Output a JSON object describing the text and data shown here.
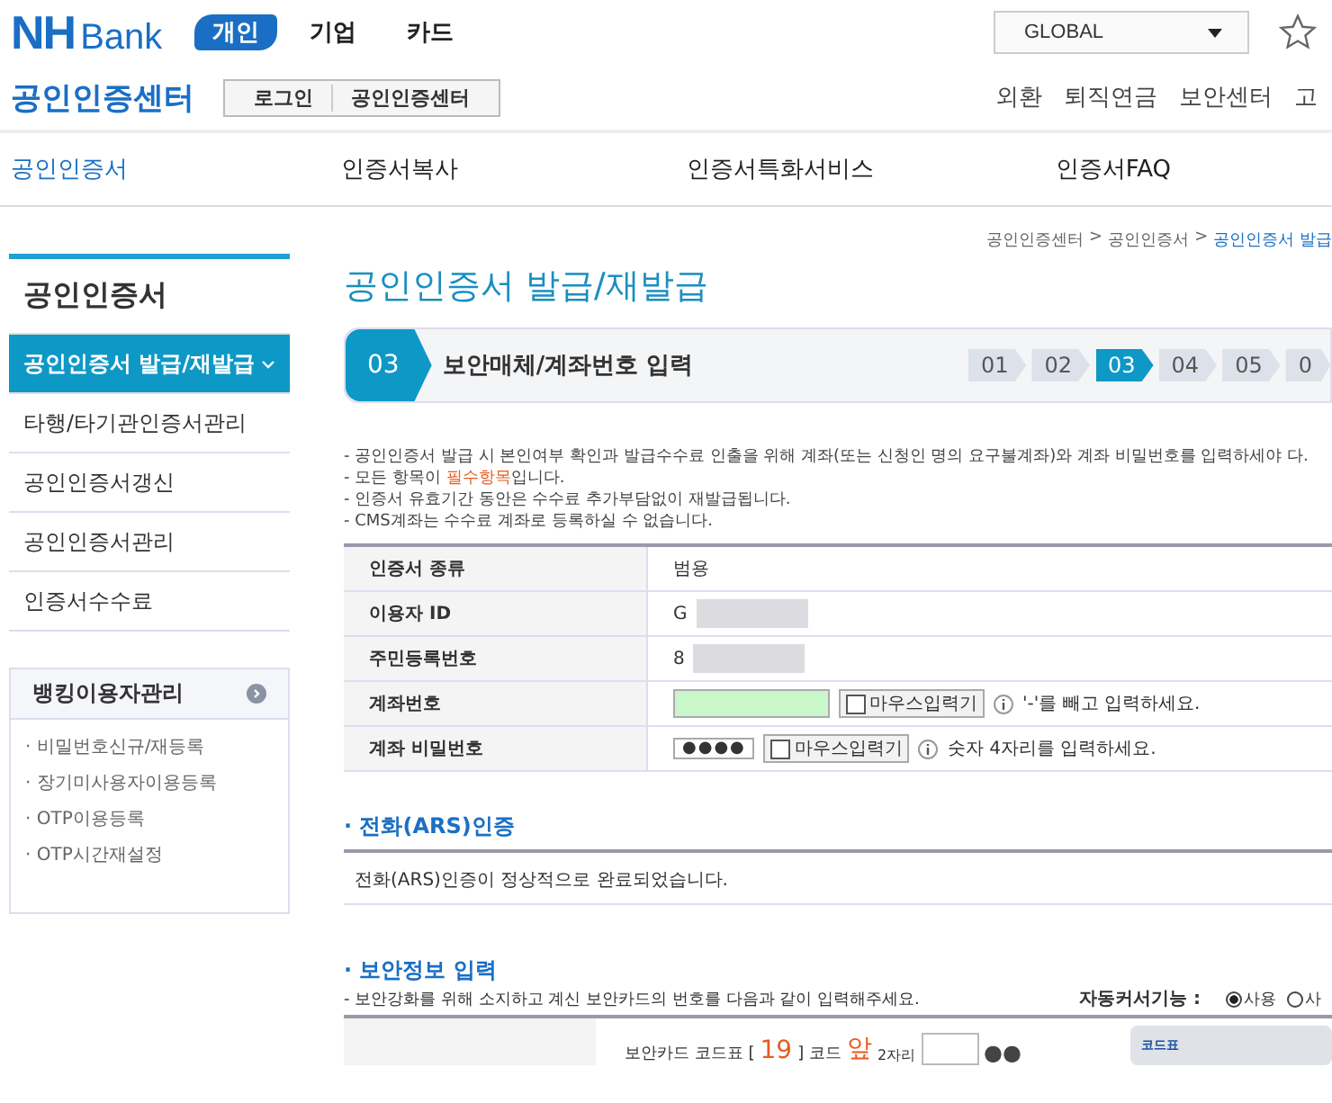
{
  "header": {
    "logo": {
      "mark": "NH",
      "word": "Bank"
    },
    "segments": [
      {
        "label": "개인",
        "selected": true
      },
      {
        "label": "기업",
        "selected": false
      },
      {
        "label": "카드",
        "selected": false
      }
    ],
    "global_select": {
      "value": "GLOBAL"
    },
    "center_title": "공인인증센터",
    "center_buttons": [
      "로그인",
      "공인인증센터"
    ],
    "links": [
      "외환",
      "퇴직연금",
      "보안센터",
      "고"
    ]
  },
  "nav": [
    {
      "label": "공인인증서",
      "selected": true
    },
    {
      "label": "인증서복사",
      "selected": false
    },
    {
      "label": "인증서특화서비스",
      "selected": false
    },
    {
      "label": "인증서FAQ",
      "selected": false
    }
  ],
  "sidebar": {
    "title": "공인인증서",
    "items": [
      {
        "label": "공인인증서 발급/재발급",
        "selected": true
      },
      {
        "label": "타행/타기관인증서관리",
        "selected": false
      },
      {
        "label": "공인인증서갱신",
        "selected": false
      },
      {
        "label": "공인인증서관리",
        "selected": false
      },
      {
        "label": "인증서수수료",
        "selected": false
      }
    ],
    "panel": {
      "title": "뱅킹이용자관리",
      "links": [
        "· 비밀번호신규/재등록",
        "· 장기미사용자이용등록",
        "· OTP이용등록",
        "· OTP시간재설정"
      ]
    }
  },
  "breadcrumb": [
    {
      "label": "공인인증센터",
      "selected": false
    },
    {
      "separator": ">",
      "label": "공인인증서",
      "selected": false
    },
    {
      "separator": ">",
      "label": "공인인증서 발급",
      "selected": true
    }
  ],
  "page_title": "공인인증서 발급/재발급",
  "step": {
    "number": "03",
    "title": "보안매체/계좌번호 입력"
  },
  "steps": [
    {
      "label": "01",
      "selected": false
    },
    {
      "label": "02",
      "selected": false
    },
    {
      "label": "03",
      "selected": true
    },
    {
      "label": "04",
      "selected": false
    },
    {
      "label": "05",
      "selected": false
    },
    {
      "label": "0",
      "selected": false
    }
  ],
  "notices": [
    {
      "text": "- 공인인증서 발급 시 본인여부 확인과 발급수수료 인출을 위해 계좌(또는 신청인 명의 요구불계좌)와 계좌 비밀번호를 입력하세야 다."
    },
    {
      "text": "- 모든 항목이 ",
      "highlight": "필수항목",
      "after": "입니다."
    },
    {
      "text": "- 인증서 유효기간 동안은 수수료 추가부담없이 재발급됩니다."
    },
    {
      "text": "- CMS계좌는 수수료 계좌로 등록하실 수 없습니다."
    }
  ],
  "form_rows": [
    {
      "kind": "text",
      "label": "인증서 종류",
      "value": "범용"
    },
    {
      "kind": "blurred",
      "label": "이용자 ID",
      "value": "G"
    },
    {
      "kind": "blurred",
      "label": "주민등록번호",
      "value": "8"
    },
    {
      "kind": "account",
      "label": "계좌번호",
      "mouse_input": {
        "label": "마우스입력기",
        "checked": false
      },
      "hint": "'-'를 빼고 입력하세요."
    },
    {
      "kind": "password",
      "label": "계좌 비밀번호",
      "value": "●●●●",
      "mouse_input": {
        "label": "마우스입력기",
        "checked": false
      },
      "hint": "숫자 4자리를 입력하세요."
    }
  ],
  "ars": {
    "title": "· 전화(ARS)인증",
    "message": "전화(ARS)인증이 정상적으로 완료되었습니다."
  },
  "security": {
    "title": "· 보안정보 입력",
    "description": "- 보안강화를 위해 소지하고 계신 보안카드의 번호를 다음과 같이 입력해주세요.",
    "auto_cursor_label": "자동커서기능 :",
    "auto_cursor_options": [
      {
        "label": "사용",
        "selected": true
      },
      {
        "label": "사",
        "selected": false
      }
    ],
    "card_prefix": "보안카드 코드표 [",
    "card_code": "19",
    "card_mid": "] 코드",
    "card_position": "앞",
    "card_suffix": "2자리",
    "card_dots": "●●",
    "card_image_title": "코드표"
  }
}
